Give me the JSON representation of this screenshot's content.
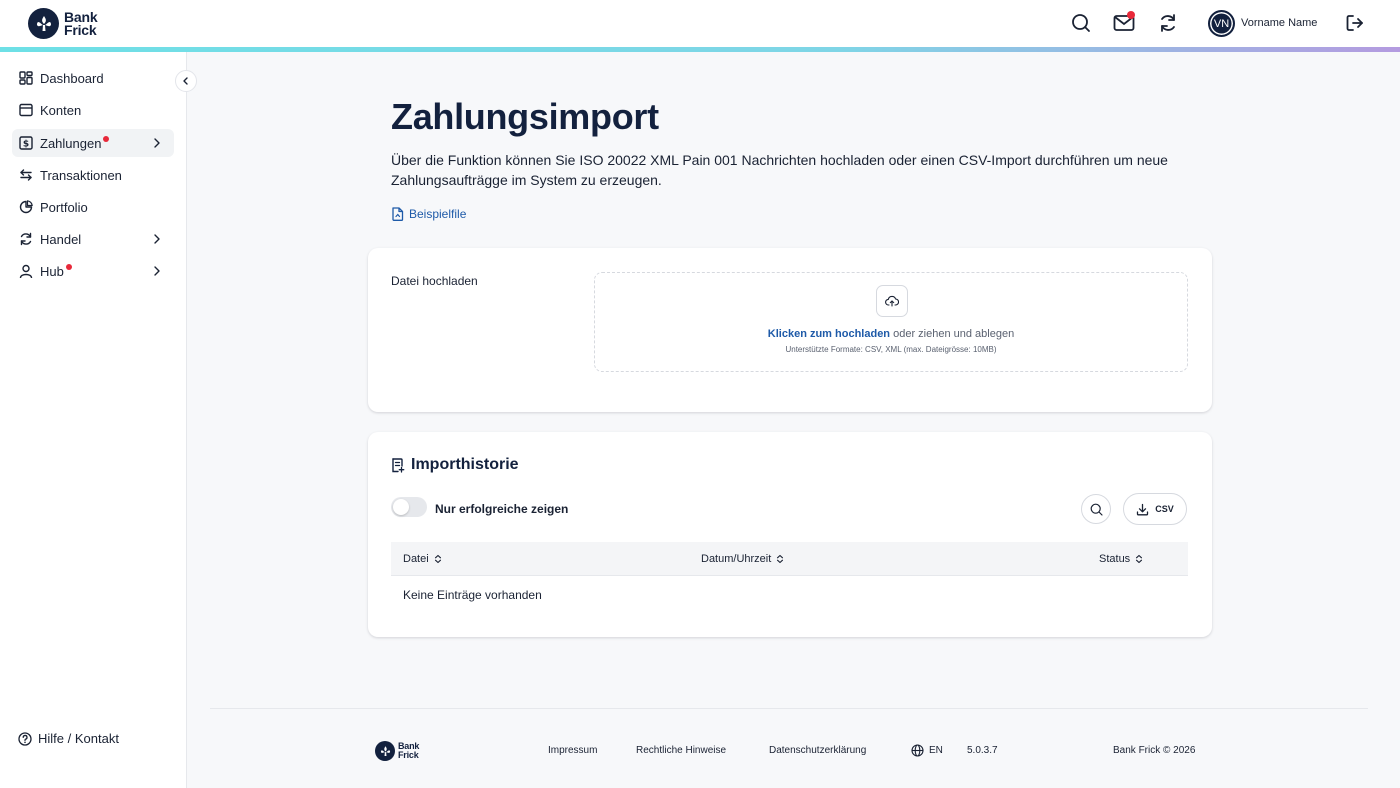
{
  "brand": {
    "line1": "Bank",
    "line2": "Frick",
    "color": "#13213e",
    "accent": "#1e5aa8",
    "alert": "#e8293a"
  },
  "header": {
    "avatar_initials": "VN",
    "user_name": "Vorname Name"
  },
  "sidebar": {
    "items": [
      {
        "label": "Dashboard"
      },
      {
        "label": "Konten"
      },
      {
        "label": "Zahlungen"
      },
      {
        "label": "Transaktionen"
      },
      {
        "label": "Portfolio"
      },
      {
        "label": "Handel"
      },
      {
        "label": "Hub"
      }
    ],
    "help_label": "Hilfe / Kontakt"
  },
  "main": {
    "title": "Zahlungsimport",
    "description": "Über die Funktion können Sie ISO 20022 XML Pain 001 Nachrichten hochladen oder einen CSV-Import durchführen um neue Zahlungsaufträgge im System zu erzeugen.",
    "example_link": "Beispielfile",
    "upload": {
      "label": "Datei hochladen",
      "cta": "Klicken zum hochladen",
      "rest": " oder ziehen und ablegen",
      "hint": "Unterstützte Formate: CSV, XML (max. Dateigrösse: 10MB)"
    },
    "history": {
      "title": "Importhistorie",
      "toggle_label": "Nur erfolgreiche zeigen",
      "csv_label": "CSV",
      "columns": [
        "Datei",
        "Datum/Uhrzeit",
        "Status"
      ],
      "empty": "Keine Einträge vorhanden"
    }
  },
  "footer": {
    "links": [
      "Impressum",
      "Rechtliche Hinweise",
      "Datenschutzerklärung"
    ],
    "language": "EN",
    "version": "5.0.3.7",
    "copyright": "Bank Frick © 2026"
  }
}
